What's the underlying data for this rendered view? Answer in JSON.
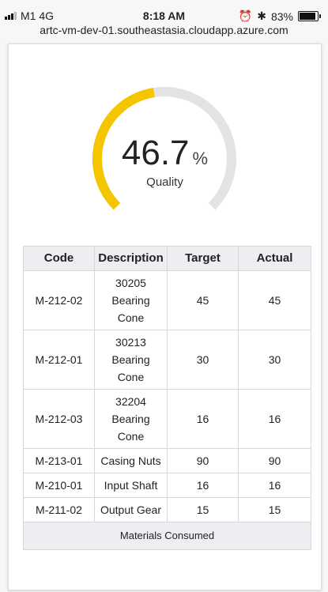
{
  "status_bar": {
    "carrier": "M1  4G",
    "time": "8:18 AM",
    "alarm_icon": "⏰",
    "bluetooth_icon": "✱",
    "battery_text": "83%",
    "battery_level": 0.83
  },
  "browser": {
    "url": "artc-vm-dev-01.southeastasia.cloudapp.azure.com"
  },
  "gauge": {
    "value": "46.7",
    "value_fraction": 0.467,
    "unit": "%",
    "label": "Quality",
    "fill_color": "#f5c500",
    "track_color": "#e3e3e3"
  },
  "table": {
    "headers": [
      "Code",
      "Description",
      "Target",
      "Actual"
    ],
    "rows": [
      {
        "code": "M-212-02",
        "description": "30205 Bearing Cone",
        "target": "45",
        "actual": "45"
      },
      {
        "code": "M-212-01",
        "description": "30213 Bearing Cone",
        "target": "30",
        "actual": "30"
      },
      {
        "code": "M-212-03",
        "description": "32204 Bearing Cone",
        "target": "16",
        "actual": "16"
      },
      {
        "code": "M-213-01",
        "description": "Casing Nuts",
        "target": "90",
        "actual": "90"
      },
      {
        "code": "M-210-01",
        "description": "Input Shaft",
        "target": "16",
        "actual": "16"
      },
      {
        "code": "M-211-02",
        "description": "Output Gear",
        "target": "15",
        "actual": "15"
      }
    ],
    "footer": "Materials Consumed"
  }
}
